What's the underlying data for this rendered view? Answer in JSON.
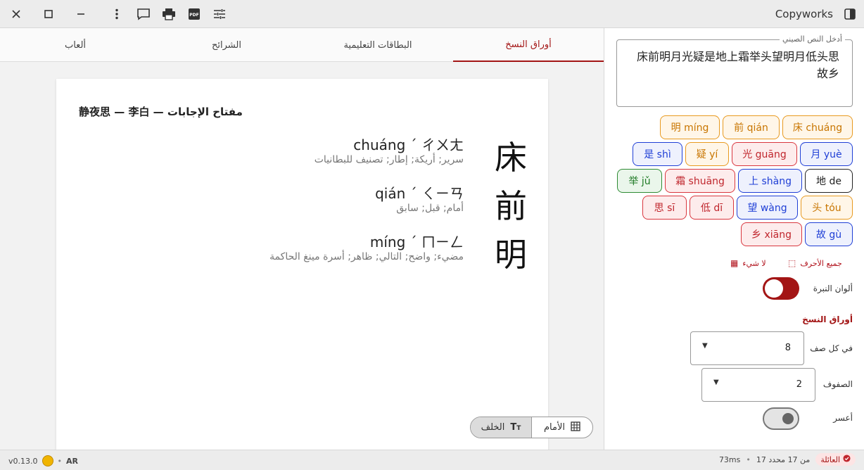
{
  "window": {
    "title": "Copyworks"
  },
  "tabs": [
    {
      "label": "أوراق النسخ"
    },
    {
      "label": "البطاقات التعليمية"
    },
    {
      "label": "الشرائح"
    },
    {
      "label": "ألعاب"
    }
  ],
  "sheet": {
    "title": "静夜思 — 李白 — مفتاح الإجابات",
    "entries": [
      {
        "char": "床",
        "pinyin": "chuáng ˊ ㄔㄨㄤ",
        "meaning": "سرير; أريكة; إطار; تصنيف للبطانيات"
      },
      {
        "char": "前",
        "pinyin": "qián ˊ ㄑㄧㄢ",
        "meaning": "أمام; قبل; سابق"
      },
      {
        "char": "明",
        "pinyin": "míng ˊ ㄇㄧㄥ",
        "meaning": "مضيء; واضح; التالي; ظاهر; أسرة مينغ الحاكمة"
      }
    ]
  },
  "view_toggle": {
    "front": "الأمام",
    "back": "الخلف"
  },
  "panel": {
    "input_legend": "أدخل النص الصيني",
    "input_value": "床前明月光疑是地上霜举头望明月低头思故乡",
    "chips": [
      {
        "label": "床 chuáng",
        "color": "orange"
      },
      {
        "label": "前 qián",
        "color": "orange"
      },
      {
        "label": "明 míng",
        "color": "orange"
      },
      {
        "label": "月 yuè",
        "color": "blue"
      },
      {
        "label": "光 guāng",
        "color": "red"
      },
      {
        "label": "疑 yí",
        "color": "orange"
      },
      {
        "label": "是 shì",
        "color": "blue"
      },
      {
        "label": "地 de",
        "color": "black"
      },
      {
        "label": "上 shàng",
        "color": "blue"
      },
      {
        "label": "霜 shuāng",
        "color": "red"
      },
      {
        "label": "举 jǔ",
        "color": "green"
      },
      {
        "label": "头 tóu",
        "color": "orange"
      },
      {
        "label": "望 wàng",
        "color": "blue"
      },
      {
        "label": "低 dī",
        "color": "red"
      },
      {
        "label": "思 sī",
        "color": "red"
      },
      {
        "label": "故 gù",
        "color": "blue"
      },
      {
        "label": "乡 xiāng",
        "color": "red"
      }
    ],
    "select_all": "جميع الأحرف",
    "select_none": "لا شيء",
    "tone_colors_label": "ألوان النبرة",
    "tone_colors_on": true,
    "copysheets_heading": "أوراق النسخ",
    "per_row_label": "في كل صف",
    "per_row_value": "8",
    "rows_label": "الصفوف",
    "rows_value": "2",
    "harder_label": "أعسر",
    "harder_on": false
  },
  "status": {
    "version": "v0.13.0",
    "lang": "AR",
    "timing": "73ms",
    "selected": "17 من 17 محدد",
    "family_badge": "العائلة"
  },
  "colors": {
    "accent": "#a31515"
  }
}
